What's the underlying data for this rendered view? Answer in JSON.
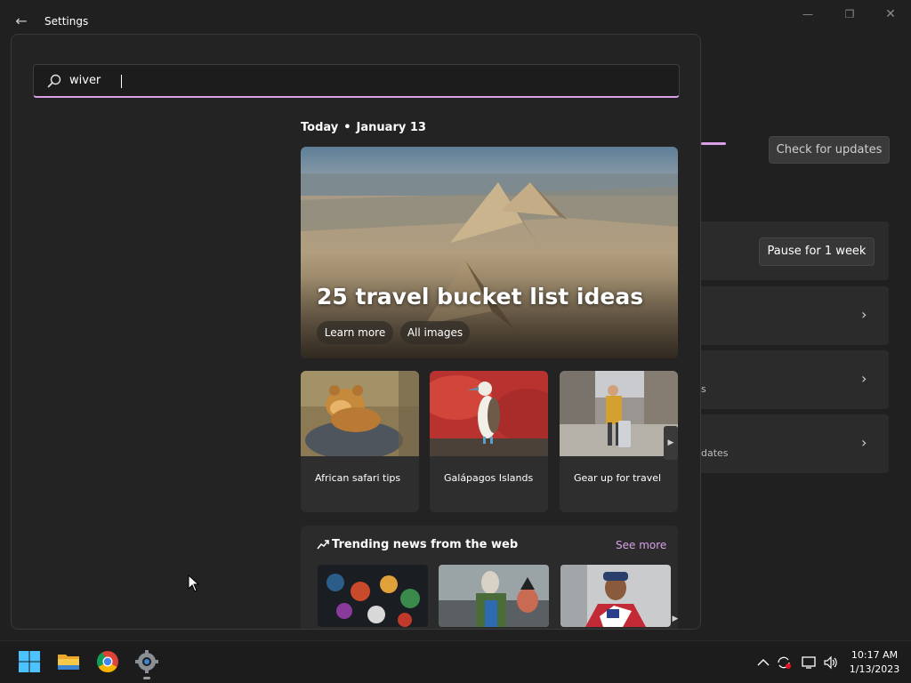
{
  "window": {
    "title": "Settings",
    "back_icon": "arrow-left-icon"
  },
  "updates": {
    "check_button": "Check for updates",
    "pause_button": "Pause for 1 week",
    "fragment_3": "s",
    "fragment_4": "dates"
  },
  "search": {
    "value": "wiver",
    "icon": "search-icon"
  },
  "today": {
    "label": "Today",
    "date": "January 13"
  },
  "hero": {
    "title": "25 travel bucket list ideas",
    "learn_more": "Learn more",
    "all_images": "All images"
  },
  "tiles": [
    {
      "label": "African safari tips"
    },
    {
      "label": "Galápagos Islands"
    },
    {
      "label": "Gear up for travel"
    }
  ],
  "trending": {
    "title": "Trending news from the web",
    "see_more": "See more"
  },
  "taskbar": {
    "apps": [
      "windows-start-icon",
      "file-explorer-icon",
      "chrome-icon",
      "settings-gear-icon"
    ],
    "time": "10:17 AM",
    "date": "1/13/2023"
  },
  "colors": {
    "accent": "#d9a0e8",
    "background": "#202020",
    "flyout": "#232323",
    "card": "#2b2b2b"
  }
}
